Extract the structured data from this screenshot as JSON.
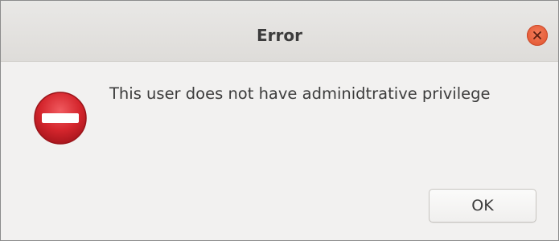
{
  "window": {
    "title": "Error",
    "close_icon": "close-icon",
    "close_color": "#e9592f"
  },
  "message": {
    "icon": "error-stop-icon",
    "icon_color": "#c8202a",
    "text": "This user does not have adminidtrative privilege"
  },
  "buttons": {
    "ok_label": "OK"
  }
}
